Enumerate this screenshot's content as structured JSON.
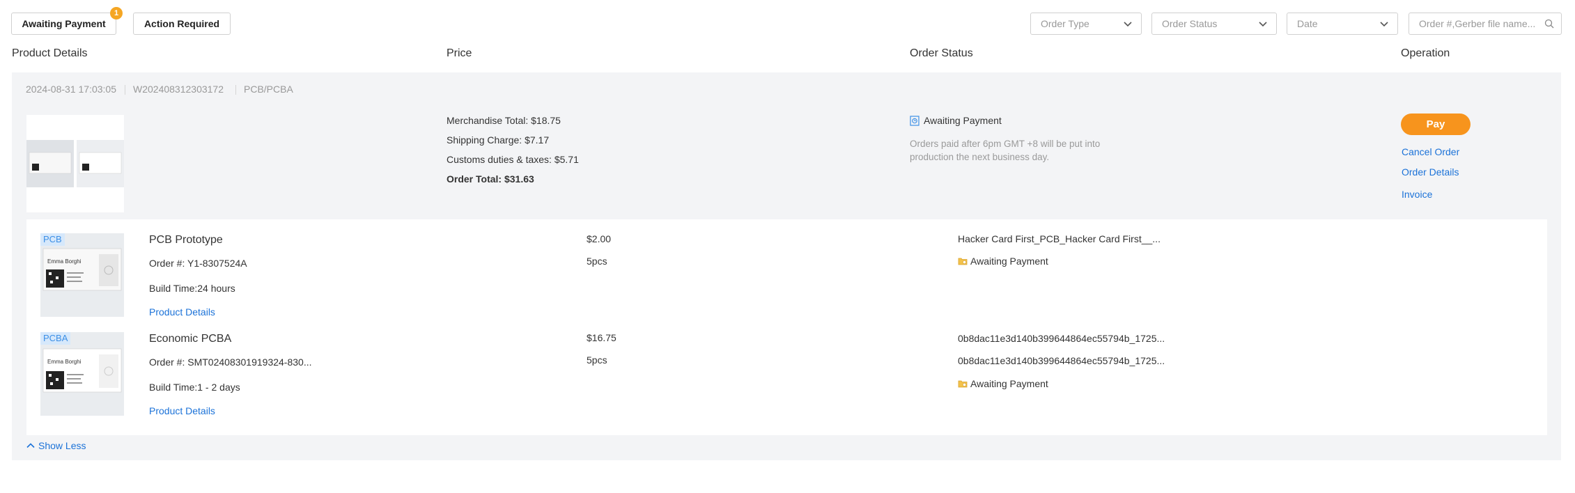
{
  "tabs": {
    "awaiting_payment": "Awaiting Payment",
    "awaiting_payment_count": "1",
    "action_required": "Action Required"
  },
  "filters": {
    "order_type": "Order Type",
    "order_status": "Order Status",
    "date": "Date",
    "search_placeholder": "Order #,Gerber file name..."
  },
  "columns": {
    "product_details": "Product Details",
    "price": "Price",
    "order_status": "Order Status",
    "operation": "Operation"
  },
  "order": {
    "datetime": "2024-08-31 17:03:05",
    "order_no": "W202408312303172",
    "category": "PCB/PCBA",
    "merchandise_total": "Merchandise Total: $18.75",
    "shipping_charge": "Shipping Charge: $7.17",
    "customs": "Customs duties & taxes: $5.71",
    "order_total": "Order Total: $31.63",
    "status": "Awaiting Payment",
    "status_note": "Orders paid after 6pm GMT +8 will be put into production the next business day.",
    "actions": {
      "pay": "Pay",
      "cancel": "Cancel Order",
      "details": "Order Details",
      "invoice": "Invoice"
    },
    "items": [
      {
        "tag": "PCB",
        "name": "PCB Prototype",
        "order_no": "Order #:  Y1-8307524A",
        "build_time": "Build Time:24 hours",
        "link": "Product Details",
        "price": "$2.00",
        "qty": "5pcs",
        "file": "Hacker Card First_PCB_Hacker Card First__...",
        "status": "Awaiting Payment",
        "thumb_name": "Emma Borghi"
      },
      {
        "tag": "PCBA",
        "name": "Economic PCBA",
        "order_no": "Order #:  SMT02408301919324-830...",
        "build_time": "Build Time:1 - 2 days",
        "link": "Product Details",
        "price": "$16.75",
        "qty": "5pcs",
        "file1": "0b8dac11e3d140b399644864ec55794b_1725...",
        "file2": "0b8dac11e3d140b399644864ec55794b_1725...",
        "status": "Awaiting Payment",
        "thumb_name": "Emma Borghi"
      }
    ],
    "show_less": "Show Less"
  },
  "colors": {
    "accent": "#1b72d8",
    "pay": "#f7941d",
    "badge": "#f5a623"
  }
}
